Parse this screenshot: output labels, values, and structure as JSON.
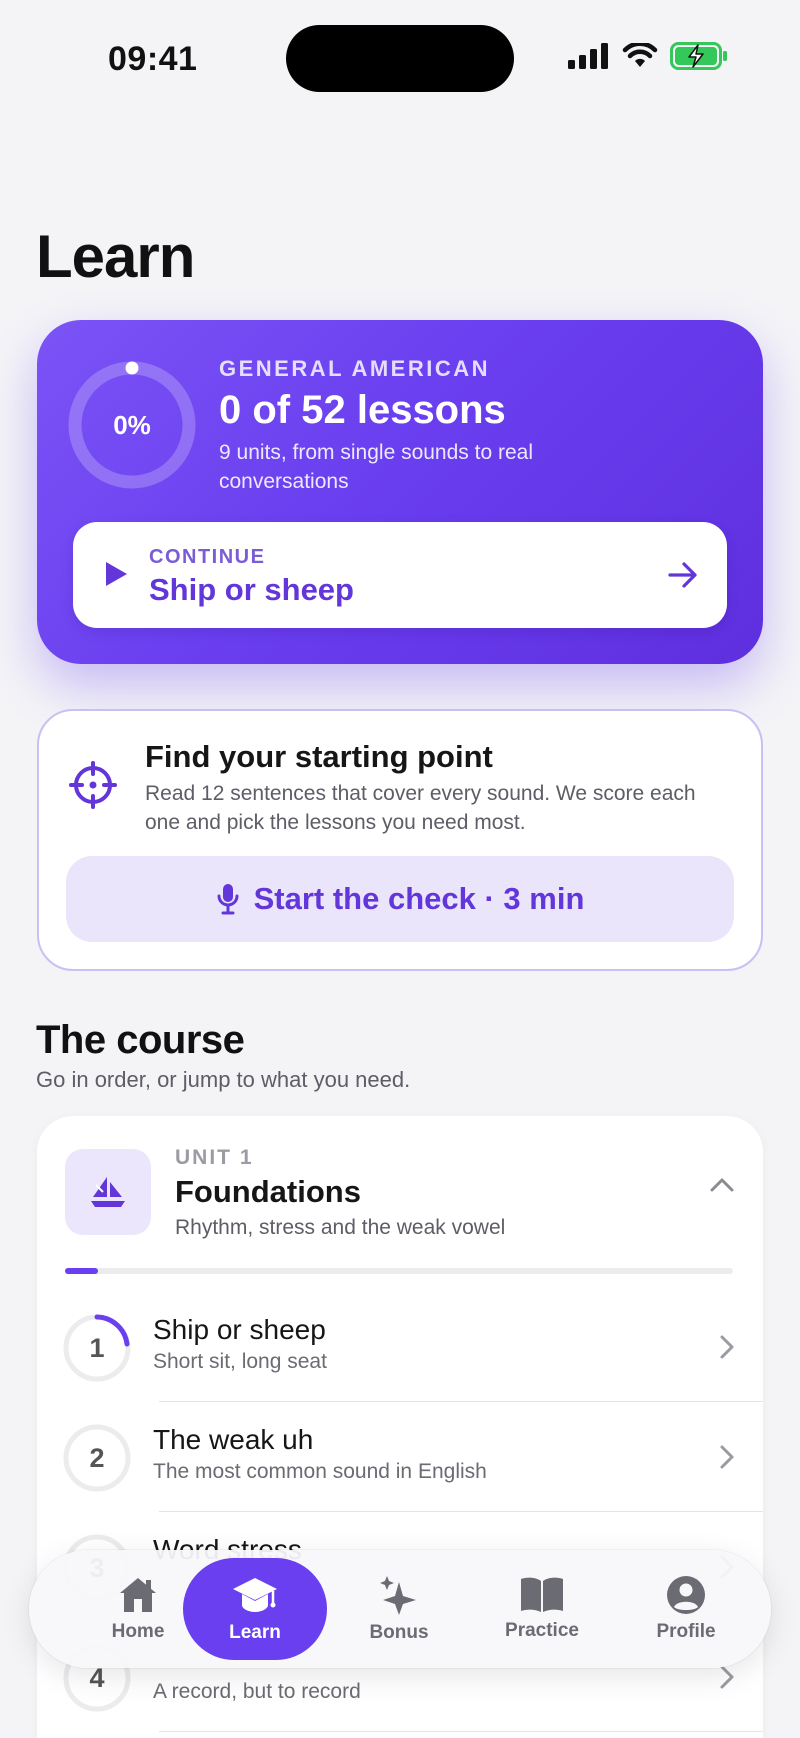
{
  "status_bar": {
    "time": "09:41"
  },
  "page_title": "Learn",
  "hero": {
    "progress_label": "0%",
    "progress_fraction": 0,
    "eyebrow": "GENERAL AMERICAN",
    "title": "0 of 52 lessons",
    "subtitle": "9 units, from single sounds to real conversations",
    "continue": {
      "eyebrow": "CONTINUE",
      "title": "Ship or sheep"
    }
  },
  "placement": {
    "title": "Find your starting point",
    "description": "Read 12 sentences that cover every sound. We score each one and pick the lessons you need most.",
    "button_label": "Start the check · 3 min"
  },
  "course": {
    "title": "The course",
    "subtitle": "Go in order, or jump to what you need.",
    "unit": {
      "eyebrow": "UNIT 1",
      "title": "Foundations",
      "subtitle": "Rhythm, stress and the weak vowel",
      "progress_fraction": 0.05
    },
    "lessons": [
      {
        "number": "1",
        "title": "Ship or sheep",
        "subtitle": "Short sit, long seat"
      },
      {
        "number": "2",
        "title": "The weak uh",
        "subtitle": "The most common sound in English"
      },
      {
        "number": "3",
        "title": "Word stress",
        "subtitle": ""
      },
      {
        "number": "4",
        "title": "",
        "subtitle": "A record, but to record"
      }
    ]
  },
  "tabbar": {
    "tabs": [
      {
        "label": "Home",
        "icon": "house-icon"
      },
      {
        "label": "Learn",
        "icon": "graduation-cap-icon"
      },
      {
        "label": "Bonus",
        "icon": "sparkles-icon"
      },
      {
        "label": "Practice",
        "icon": "book-icon"
      },
      {
        "label": "Profile",
        "icon": "person-circle-icon"
      }
    ],
    "active": "Learn"
  },
  "colors": {
    "accent": "#6A3FEF",
    "accent_light": "#EBE5FC",
    "battery": "#34C759"
  }
}
